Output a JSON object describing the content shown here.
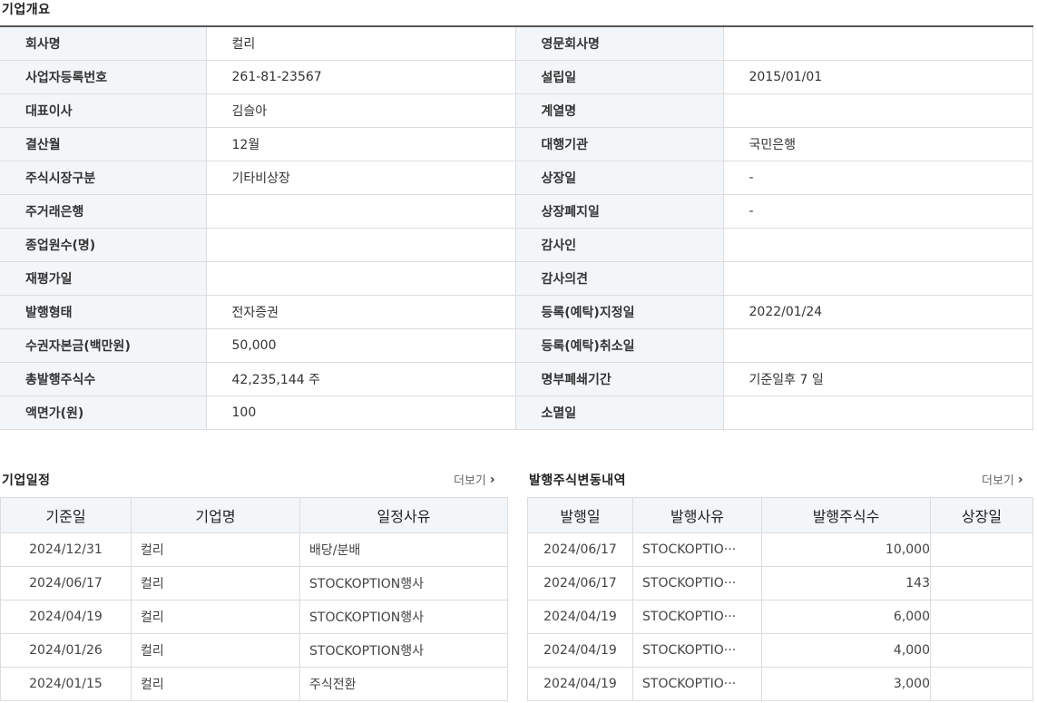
{
  "overview": {
    "title": "기업개요",
    "rows": [
      {
        "l1": "회사명",
        "v1": "컬리",
        "l2": "영문회사명",
        "v2": ""
      },
      {
        "l1": "사업자등록번호",
        "v1": "261-81-23567",
        "l2": "설립일",
        "v2": "2015/01/01"
      },
      {
        "l1": "대표이사",
        "v1": "김슬아",
        "l2": "계열명",
        "v2": ""
      },
      {
        "l1": "결산월",
        "v1": "12월",
        "l2": "대행기관",
        "v2": "국민은행"
      },
      {
        "l1": "주식시장구분",
        "v1": "기타비상장",
        "l2": "상장일",
        "v2": "-"
      },
      {
        "l1": "주거래은행",
        "v1": "",
        "l2": "상장폐지일",
        "v2": "-"
      },
      {
        "l1": "종업원수(명)",
        "v1": "",
        "l2": "감사인",
        "v2": ""
      },
      {
        "l1": "재평가일",
        "v1": "",
        "l2": "감사의견",
        "v2": ""
      },
      {
        "l1": "발행형태",
        "v1": "전자증권",
        "l2": "등록(예탁)지정일",
        "v2": "2022/01/24"
      },
      {
        "l1": "수권자본금(백만원)",
        "v1": "50,000",
        "l2": "등록(예탁)취소일",
        "v2": ""
      },
      {
        "l1": "총발행주식수",
        "v1": "42,235,144 주",
        "l2": "명부폐쇄기간",
        "v2": "기준일후 7 일"
      },
      {
        "l1": "액면가(원)",
        "v1": "100",
        "l2": "소멸일",
        "v2": ""
      }
    ]
  },
  "schedule": {
    "title": "기업일정",
    "more_label": "더보기",
    "headers": [
      "기준일",
      "기업명",
      "일정사유"
    ],
    "rows": [
      [
        "2024/12/31",
        "컬리",
        "배당/분배"
      ],
      [
        "2024/06/17",
        "컬리",
        "STOCKOPTION행사"
      ],
      [
        "2024/04/19",
        "컬리",
        "STOCKOPTION행사"
      ],
      [
        "2024/01/26",
        "컬리",
        "STOCKOPTION행사"
      ],
      [
        "2024/01/15",
        "컬리",
        "주식전환"
      ]
    ]
  },
  "shares": {
    "title": "발행주식변동내역",
    "more_label": "더보기",
    "headers": [
      "발행일",
      "발행사유",
      "발행주식수",
      "상장일"
    ],
    "rows": [
      [
        "2024/06/17",
        "STOCKOPTIO···",
        "10,000",
        ""
      ],
      [
        "2024/06/17",
        "STOCKOPTIO···",
        "143",
        ""
      ],
      [
        "2024/04/19",
        "STOCKOPTIO···",
        "6,000",
        ""
      ],
      [
        "2024/04/19",
        "STOCKOPTIO···",
        "4,000",
        ""
      ],
      [
        "2024/04/19",
        "STOCKOPTIO···",
        "3,000",
        ""
      ]
    ]
  }
}
